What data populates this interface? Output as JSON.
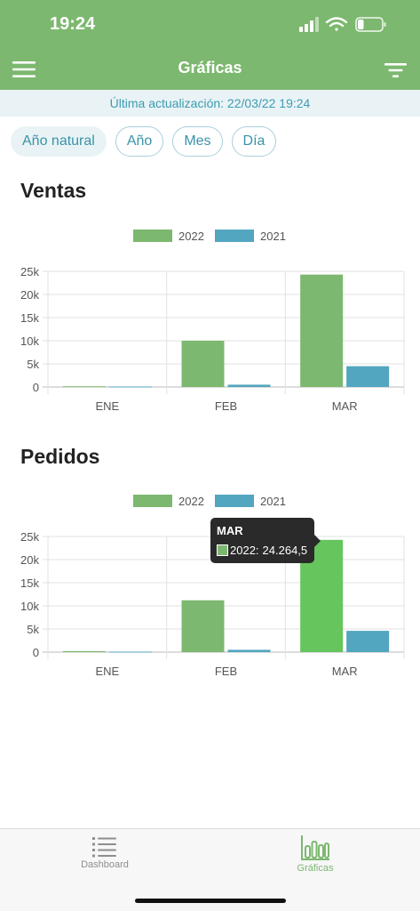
{
  "status": {
    "time": "19:24",
    "battery_fill": 0.25
  },
  "header": {
    "title": "Gráficas"
  },
  "update": {
    "text": "Última actualización: 22/03/22 19:24"
  },
  "filters": [
    {
      "label": "Año natural",
      "active": true
    },
    {
      "label": "Año",
      "active": false
    },
    {
      "label": "Mes",
      "active": false
    },
    {
      "label": "Día",
      "active": false
    }
  ],
  "sections": {
    "ventas": "Ventas",
    "pedidos": "Pedidos"
  },
  "colors": {
    "primary": "#7cb86f",
    "series_2022": "#7cb86f",
    "series_2021": "#53a6bf",
    "highlight_2022": "#66c55c",
    "accent_text": "#3a93a8"
  },
  "chart_data": [
    {
      "type": "bar",
      "title": "Ventas",
      "categories": [
        "ENE",
        "FEB",
        "MAR"
      ],
      "series": [
        {
          "name": "2022",
          "values": [
            150,
            10000,
            24300
          ]
        },
        {
          "name": "2021",
          "values": [
            100,
            500,
            4500
          ]
        }
      ],
      "ylim": [
        0,
        25000
      ],
      "yticks": [
        "0",
        "5k",
        "10k",
        "15k",
        "20k",
        "25k"
      ],
      "grid": true,
      "legend": "top"
    },
    {
      "type": "bar",
      "title": "Pedidos",
      "categories": [
        "ENE",
        "FEB",
        "MAR"
      ],
      "series": [
        {
          "name": "2022",
          "values": [
            200,
            11200,
            24264.5
          ]
        },
        {
          "name": "2021",
          "values": [
            100,
            500,
            4600
          ]
        }
      ],
      "ylim": [
        0,
        25000
      ],
      "yticks": [
        "0",
        "5k",
        "10k",
        "15k",
        "20k",
        "25k"
      ],
      "grid": true,
      "legend": "top",
      "highlight": {
        "series": 0,
        "category": 2
      }
    }
  ],
  "tooltip": {
    "title": "MAR",
    "series": "2022:",
    "value": "24.264,5"
  },
  "tabs": [
    {
      "label": "Dashboard",
      "icon": "list-icon",
      "active": false
    },
    {
      "label": "Gráficas",
      "icon": "bar-chart-icon",
      "active": true
    }
  ]
}
